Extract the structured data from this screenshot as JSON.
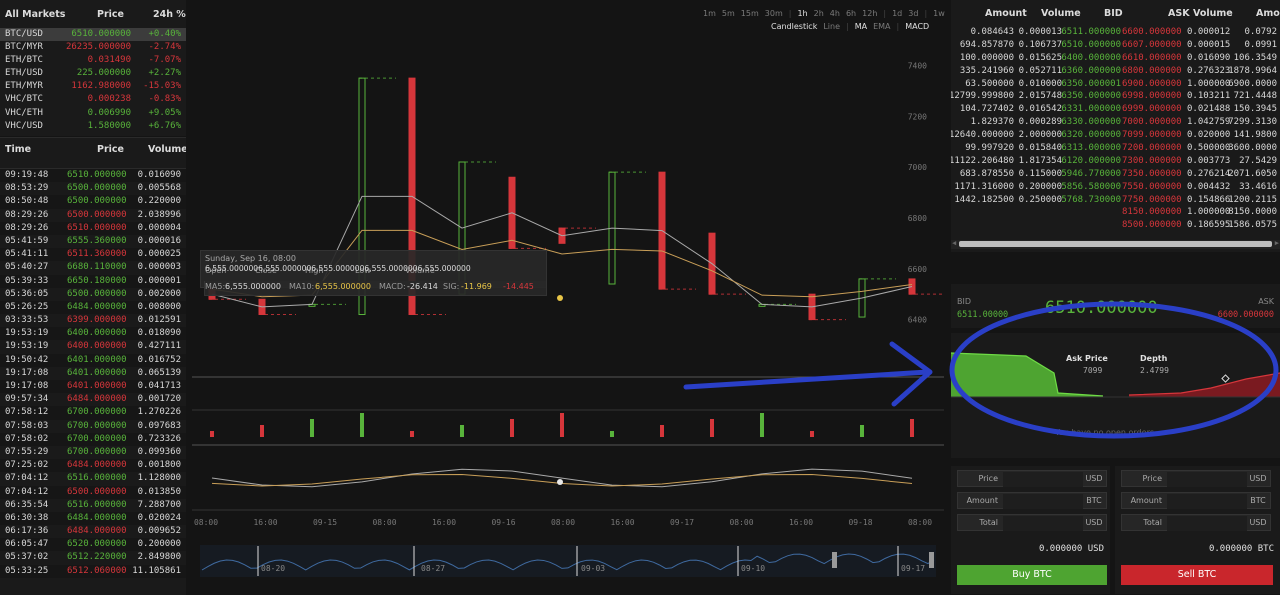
{
  "markets": {
    "headers": {
      "market": "All Markets",
      "price": "Price",
      "change": "24h %"
    },
    "rows": [
      {
        "pair": "BTC/USD",
        "price": "6510.000000",
        "change": "+0.40%",
        "dir": "up"
      },
      {
        "pair": "BTC/MYR",
        "price": "26235.000000",
        "change": "-2.74%",
        "dir": "down"
      },
      {
        "pair": "ETH/BTC",
        "price": "0.031490",
        "change": "-7.07%",
        "dir": "down"
      },
      {
        "pair": "ETH/USD",
        "price": "225.000000",
        "change": "+2.27%",
        "dir": "up"
      },
      {
        "pair": "ETH/MYR",
        "price": "1162.980000",
        "change": "-15.03%",
        "dir": "down"
      },
      {
        "pair": "VHC/BTC",
        "price": "0.000238",
        "change": "-0.83%",
        "dir": "down"
      },
      {
        "pair": "VHC/ETH",
        "price": "0.006990",
        "change": "+9.05%",
        "dir": "up"
      },
      {
        "pair": "VHC/USD",
        "price": "1.580000",
        "change": "+6.76%",
        "dir": "up"
      }
    ]
  },
  "trades": {
    "headers": {
      "time": "Time",
      "price": "Price",
      "volume": "Volume"
    },
    "rows": [
      {
        "time": "09:19:48",
        "price": "6510.000000",
        "volume": "0.016090",
        "dir": "up"
      },
      {
        "time": "08:53:29",
        "price": "6500.000000",
        "volume": "0.005568",
        "dir": "up"
      },
      {
        "time": "08:50:48",
        "price": "6500.000000",
        "volume": "0.220000",
        "dir": "up"
      },
      {
        "time": "08:29:26",
        "price": "6500.000000",
        "volume": "2.038996",
        "dir": "down"
      },
      {
        "time": "08:29:26",
        "price": "6510.000000",
        "volume": "0.000004",
        "dir": "down"
      },
      {
        "time": "05:41:59",
        "price": "6555.360000",
        "volume": "0.000016",
        "dir": "up"
      },
      {
        "time": "05:41:11",
        "price": "6511.360000",
        "volume": "0.000025",
        "dir": "down"
      },
      {
        "time": "05:40:27",
        "price": "6680.110000",
        "volume": "0.000003",
        "dir": "up"
      },
      {
        "time": "05:39:33",
        "price": "6650.180000",
        "volume": "0.000001",
        "dir": "up"
      },
      {
        "time": "05:36:05",
        "price": "6500.000000",
        "volume": "0.002000",
        "dir": "up"
      },
      {
        "time": "05:26:25",
        "price": "6484.000000",
        "volume": "0.008000",
        "dir": "up"
      },
      {
        "time": "03:33:53",
        "price": "6399.000000",
        "volume": "0.012591",
        "dir": "down"
      },
      {
        "time": "19:53:19",
        "price": "6400.000000",
        "volume": "0.018090",
        "dir": "up"
      },
      {
        "time": "19:53:19",
        "price": "6400.000000",
        "volume": "0.427111",
        "dir": "down"
      },
      {
        "time": "19:50:42",
        "price": "6401.000000",
        "volume": "0.016752",
        "dir": "up"
      },
      {
        "time": "19:17:08",
        "price": "6401.000000",
        "volume": "0.065139",
        "dir": "up"
      },
      {
        "time": "19:17:08",
        "price": "6401.000000",
        "volume": "0.041713",
        "dir": "down"
      },
      {
        "time": "09:57:34",
        "price": "6484.000000",
        "volume": "0.001720",
        "dir": "down"
      },
      {
        "time": "07:58:12",
        "price": "6700.000000",
        "volume": "1.270226",
        "dir": "up"
      },
      {
        "time": "07:58:03",
        "price": "6700.000000",
        "volume": "0.097683",
        "dir": "up"
      },
      {
        "time": "07:58:02",
        "price": "6700.000000",
        "volume": "0.723326",
        "dir": "up"
      },
      {
        "time": "07:55:29",
        "price": "6700.000000",
        "volume": "0.099360",
        "dir": "up"
      },
      {
        "time": "07:25:02",
        "price": "6484.000000",
        "volume": "0.001800",
        "dir": "down"
      },
      {
        "time": "07:04:12",
        "price": "6516.000000",
        "volume": "1.128000",
        "dir": "up"
      },
      {
        "time": "07:04:12",
        "price": "6500.000000",
        "volume": "0.013850",
        "dir": "down"
      },
      {
        "time": "06:35:54",
        "price": "6516.000000",
        "volume": "7.288700",
        "dir": "up"
      },
      {
        "time": "06:30:38",
        "price": "6484.000000",
        "volume": "0.020024",
        "dir": "up"
      },
      {
        "time": "06:17:36",
        "price": "6484.000000",
        "volume": "0.009652",
        "dir": "down"
      },
      {
        "time": "06:05:47",
        "price": "6520.000000",
        "volume": "0.200000",
        "dir": "up"
      },
      {
        "time": "05:37:02",
        "price": "6512.220000",
        "volume": "2.849800",
        "dir": "up"
      },
      {
        "time": "05:33:25",
        "price": "6512.060000",
        "volume": "11.105861",
        "dir": "down"
      }
    ]
  },
  "chart": {
    "timeframes": [
      "1m",
      "5m",
      "15m",
      "30m",
      "|",
      "1h",
      "2h",
      "4h",
      "6h",
      "12h",
      "|",
      "1d",
      "3d",
      "|",
      "1w"
    ],
    "active_timeframe": "1h",
    "chart_types": [
      "Candlestick",
      "Line",
      "|",
      "MA",
      "EMA",
      "|",
      "MACD"
    ],
    "y_ticks": [
      "7400",
      "7200",
      "7000",
      "6800",
      "6600",
      "6400"
    ],
    "x_ticks": [
      "08:00",
      "16:00",
      "09-15",
      "08:00",
      "16:00",
      "09-16",
      "08:00",
      "16:00",
      "09-17",
      "08:00",
      "16:00",
      "09-18",
      "08:00"
    ],
    "nav_ticks": [
      "08-20",
      "08-27",
      "09-03",
      "09-10",
      "09-17"
    ],
    "tooltip": {
      "date": "Sunday, Sep 16, 08:00",
      "labels": [
        "Open",
        "Close",
        "High",
        "Low",
        "Volume"
      ],
      "values": "6,555.0000006,555.0000006,555.0000006,555.0000006,555.000000",
      "ma5_label": "MA5:",
      "ma5": "6,555.000000",
      "ma10_label": "MA10:",
      "ma10": "6,555.000000",
      "macd_label": "MACD:",
      "macd": "-26.414",
      "sig_label": "SIG:",
      "sig": "-11.969",
      "hist": "-14.445"
    }
  },
  "chart_data": {
    "type": "candlestick",
    "title": "",
    "xlabel": "",
    "ylabel": "",
    "ylim": [
      6300,
      7500
    ],
    "candles": [
      {
        "o": 6520,
        "c": 6480,
        "dir": "down"
      },
      {
        "o": 6480,
        "c": 6420,
        "dir": "down"
      },
      {
        "o": 6460,
        "c": 6460,
        "dir": "up"
      },
      {
        "o": 6420,
        "c": 7350,
        "dir": "up"
      },
      {
        "o": 7350,
        "c": 6420,
        "dir": "down"
      },
      {
        "o": 6500,
        "c": 7020,
        "dir": "up"
      },
      {
        "o": 6960,
        "c": 6680,
        "dir": "down"
      },
      {
        "o": 6700,
        "c": 6760,
        "dir": "down"
      },
      {
        "o": 6540,
        "c": 6980,
        "dir": "up"
      },
      {
        "o": 6980,
        "c": 6520,
        "dir": "down"
      },
      {
        "o": 6740,
        "c": 6500,
        "dir": "down"
      },
      {
        "o": 6460,
        "c": 6460,
        "dir": "up"
      },
      {
        "o": 6500,
        "c": 6400,
        "dir": "down"
      },
      {
        "o": 6410,
        "c": 6560,
        "dir": "up"
      },
      {
        "o": 6560,
        "c": 6500,
        "dir": "down"
      }
    ]
  },
  "orderbook": {
    "bid_headers": {
      "amount": "Amount",
      "volume": "Volume",
      "price": "BID"
    },
    "ask_headers": {
      "price": "ASK",
      "volume": "Volume",
      "amount": "Amou"
    },
    "bids": [
      {
        "amount": "0.084643",
        "volume": "0.000013",
        "price": "6511.000000"
      },
      {
        "amount": "694.857870",
        "volume": "0.106737",
        "price": "6510.000000"
      },
      {
        "amount": "100.000000",
        "volume": "0.015625",
        "price": "6400.000000"
      },
      {
        "amount": "335.241960",
        "volume": "0.052711",
        "price": "6360.000000"
      },
      {
        "amount": "63.500000",
        "volume": "0.010000",
        "price": "6350.000001"
      },
      {
        "amount": "12799.999800",
        "volume": "2.015748",
        "price": "6350.000000"
      },
      {
        "amount": "104.727402",
        "volume": "0.016542",
        "price": "6331.000000"
      },
      {
        "amount": "1.829370",
        "volume": "0.000289",
        "price": "6330.000000"
      },
      {
        "amount": "12640.000000",
        "volume": "2.000000",
        "price": "6320.000000"
      },
      {
        "amount": "99.997920",
        "volume": "0.015840",
        "price": "6313.000000"
      },
      {
        "amount": "11122.206480",
        "volume": "1.817354",
        "price": "6120.000000"
      },
      {
        "amount": "683.878550",
        "volume": "0.115000",
        "price": "5946.770000"
      },
      {
        "amount": "1171.316000",
        "volume": "0.200000",
        "price": "5856.580000"
      },
      {
        "amount": "1442.182500",
        "volume": "0.250000",
        "price": "5768.730000"
      }
    ],
    "asks": [
      {
        "price": "6600.000000",
        "volume": "0.000012",
        "amount": "0.0792"
      },
      {
        "price": "6607.000000",
        "volume": "0.000015",
        "amount": "0.0991"
      },
      {
        "price": "6610.000000",
        "volume": "0.016090",
        "amount": "106.3549"
      },
      {
        "price": "6800.000000",
        "volume": "0.276323",
        "amount": "1878.9964"
      },
      {
        "price": "6900.000000",
        "volume": "1.000000",
        "amount": "6900.0000"
      },
      {
        "price": "6998.000000",
        "volume": "0.103211",
        "amount": "721.4448"
      },
      {
        "price": "6999.000000",
        "volume": "0.021488",
        "amount": "150.3945"
      },
      {
        "price": "7000.000000",
        "volume": "1.042759",
        "amount": "7299.3130"
      },
      {
        "price": "7099.000000",
        "volume": "0.020000",
        "amount": "141.9800"
      },
      {
        "price": "7200.000000",
        "volume": "0.500000",
        "amount": "3600.0000"
      },
      {
        "price": "7300.000000",
        "volume": "0.003773",
        "amount": "27.5429"
      },
      {
        "price": "7350.000000",
        "volume": "0.276214",
        "amount": "2071.6050"
      },
      {
        "price": "7550.000000",
        "volume": "0.004432",
        "amount": "33.4616"
      },
      {
        "price": "7750.000000",
        "volume": "0.154866",
        "amount": "1200.2115"
      },
      {
        "price": "8150.000000",
        "volume": "1.000000",
        "amount": "8150.0000"
      },
      {
        "price": "8500.000000",
        "volume": "0.186595",
        "amount": "1586.0575"
      }
    ]
  },
  "ticker": {
    "bid_label": "BID",
    "bid_value": "6511.00000",
    "last_price": "6510.000000",
    "ask_label": "ASK",
    "ask_value": "6600.000000"
  },
  "depth": {
    "ask_price_label": "Ask Price",
    "ask_price": "7099",
    "depth_label": "Depth",
    "depth": "2.4799",
    "open_orders_text": "You have no open orders."
  },
  "buy_form": {
    "price_label": "Price",
    "price_unit": "USD",
    "amount_label": "Amount",
    "amount_unit": "BTC",
    "total_label": "Total",
    "total_unit": "USD",
    "total_value": "0.000000 USD",
    "button": "Buy BTC"
  },
  "sell_form": {
    "price_label": "Price",
    "price_unit": "USD",
    "amount_label": "Amount",
    "amount_unit": "BTC",
    "total_label": "Total",
    "total_unit": "USD",
    "total_value": "0.000000 BTC",
    "button": "Sell BTC"
  },
  "colors": {
    "up": "#58b33b",
    "down": "#d6363b",
    "annotation": "#2a3fc7"
  }
}
